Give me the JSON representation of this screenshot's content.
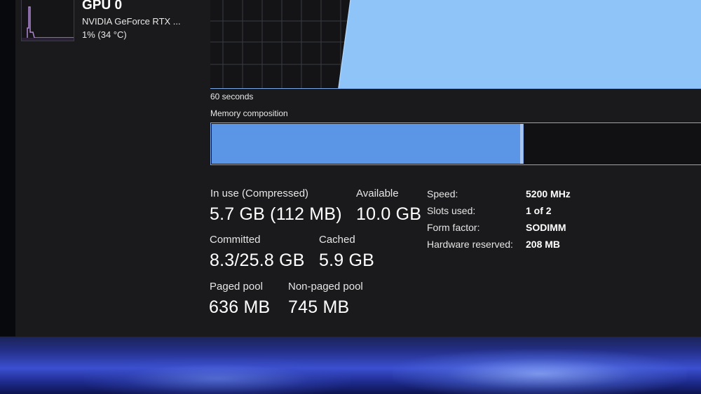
{
  "colors": {
    "window_bg": "#1a1a1c",
    "accent_line": "#7aa7e6",
    "in_use_fill": "#5b95e6",
    "chart_area": "#8ec4f7"
  },
  "sidebar": {
    "gpu": {
      "title": "GPU 0",
      "name": "NVIDIA GeForce RTX ...",
      "usage": "1% (34 °C)"
    }
  },
  "chart": {
    "time_label": "60 seconds"
  },
  "composition": {
    "title": "Memory composition",
    "in_use_fraction": 0.63,
    "modified_fraction": 0.006
  },
  "stats": {
    "in_use": {
      "label": "In use (Compressed)",
      "value": "5.7 GB (112 MB)"
    },
    "available": {
      "label": "Available",
      "value": "10.0 GB"
    },
    "committed": {
      "label": "Committed",
      "value": "8.3/25.8 GB"
    },
    "cached": {
      "label": "Cached",
      "value": "5.9 GB"
    },
    "paged_pool": {
      "label": "Paged pool",
      "value": "636 MB"
    },
    "non_paged_pool": {
      "label": "Non-paged pool",
      "value": "745 MB"
    }
  },
  "specs": {
    "speed": {
      "label": "Speed:",
      "value": "5200 MHz"
    },
    "slots": {
      "label": "Slots used:",
      "value": "1 of 2"
    },
    "form": {
      "label": "Form factor:",
      "value": "SODIMM"
    },
    "reserved": {
      "label": "Hardware reserved:",
      "value": "208 MB"
    }
  }
}
